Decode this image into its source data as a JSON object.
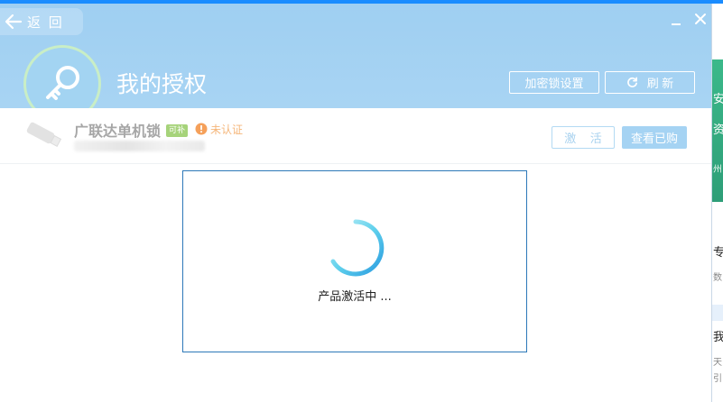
{
  "header": {
    "back_label": "返 回",
    "title": "我的授权",
    "lock_settings_label": "加密锁设置",
    "refresh_label": "刷 新"
  },
  "product": {
    "name": "广联达单机锁",
    "badge": "可补",
    "status": "未认证",
    "activate_label": "激 活",
    "view_purchased_label": "查看已购"
  },
  "dialog": {
    "message": "产品激活中 ..."
  },
  "background_app": {
    "chars": [
      "安",
      "资",
      "州",
      "专",
      "数",
      "我",
      "天",
      "引"
    ]
  },
  "colors": {
    "header_bg": "#a3d2f2",
    "dialog_border": "#2d78b8",
    "spinner": "#38a8e6",
    "status_warning": "#f5a05a",
    "badge_green": "#a6d37a",
    "bg_app_green": "#35ab83"
  },
  "icons": {
    "back": "arrow-left-icon",
    "minimize": "minimize-icon",
    "close": "close-icon",
    "key": "key-icon",
    "refresh": "refresh-icon",
    "usb": "usb-drive-icon",
    "warning": "warning-icon",
    "spinner": "loading-spinner-icon"
  }
}
